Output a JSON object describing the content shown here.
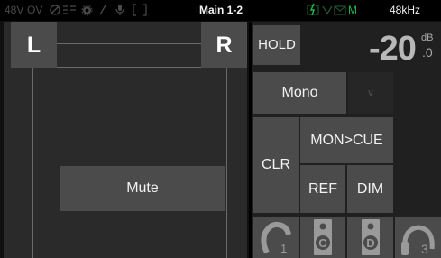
{
  "statusbar": {
    "indicator_48v": "48V",
    "indicator_ov": "OV",
    "title": "Main 1-2",
    "indicator_m": "M",
    "sample_rate": "48kHz"
  },
  "routing": {
    "left_label": "L",
    "right_label": "R",
    "mute_label": "Mute"
  },
  "controls": {
    "hold_label": "HOLD",
    "level_value": "-20",
    "level_unit": "dB",
    "level_decimal": ".0",
    "mono_label": "Mono",
    "dropdown_glyph": "v",
    "clr_label": "CLR",
    "mon_cue_label": "MON>CUE",
    "ref_label": "REF",
    "dim_label": "DIM",
    "headphone_1_number": "1",
    "speaker_c_letter": "C",
    "speaker_d_letter": "D",
    "headphone_3_number": "3"
  },
  "colors": {
    "status_green": "#1fb84a",
    "button_gray": "#4b4b4b",
    "panel_gray": "#2a2a2a"
  }
}
